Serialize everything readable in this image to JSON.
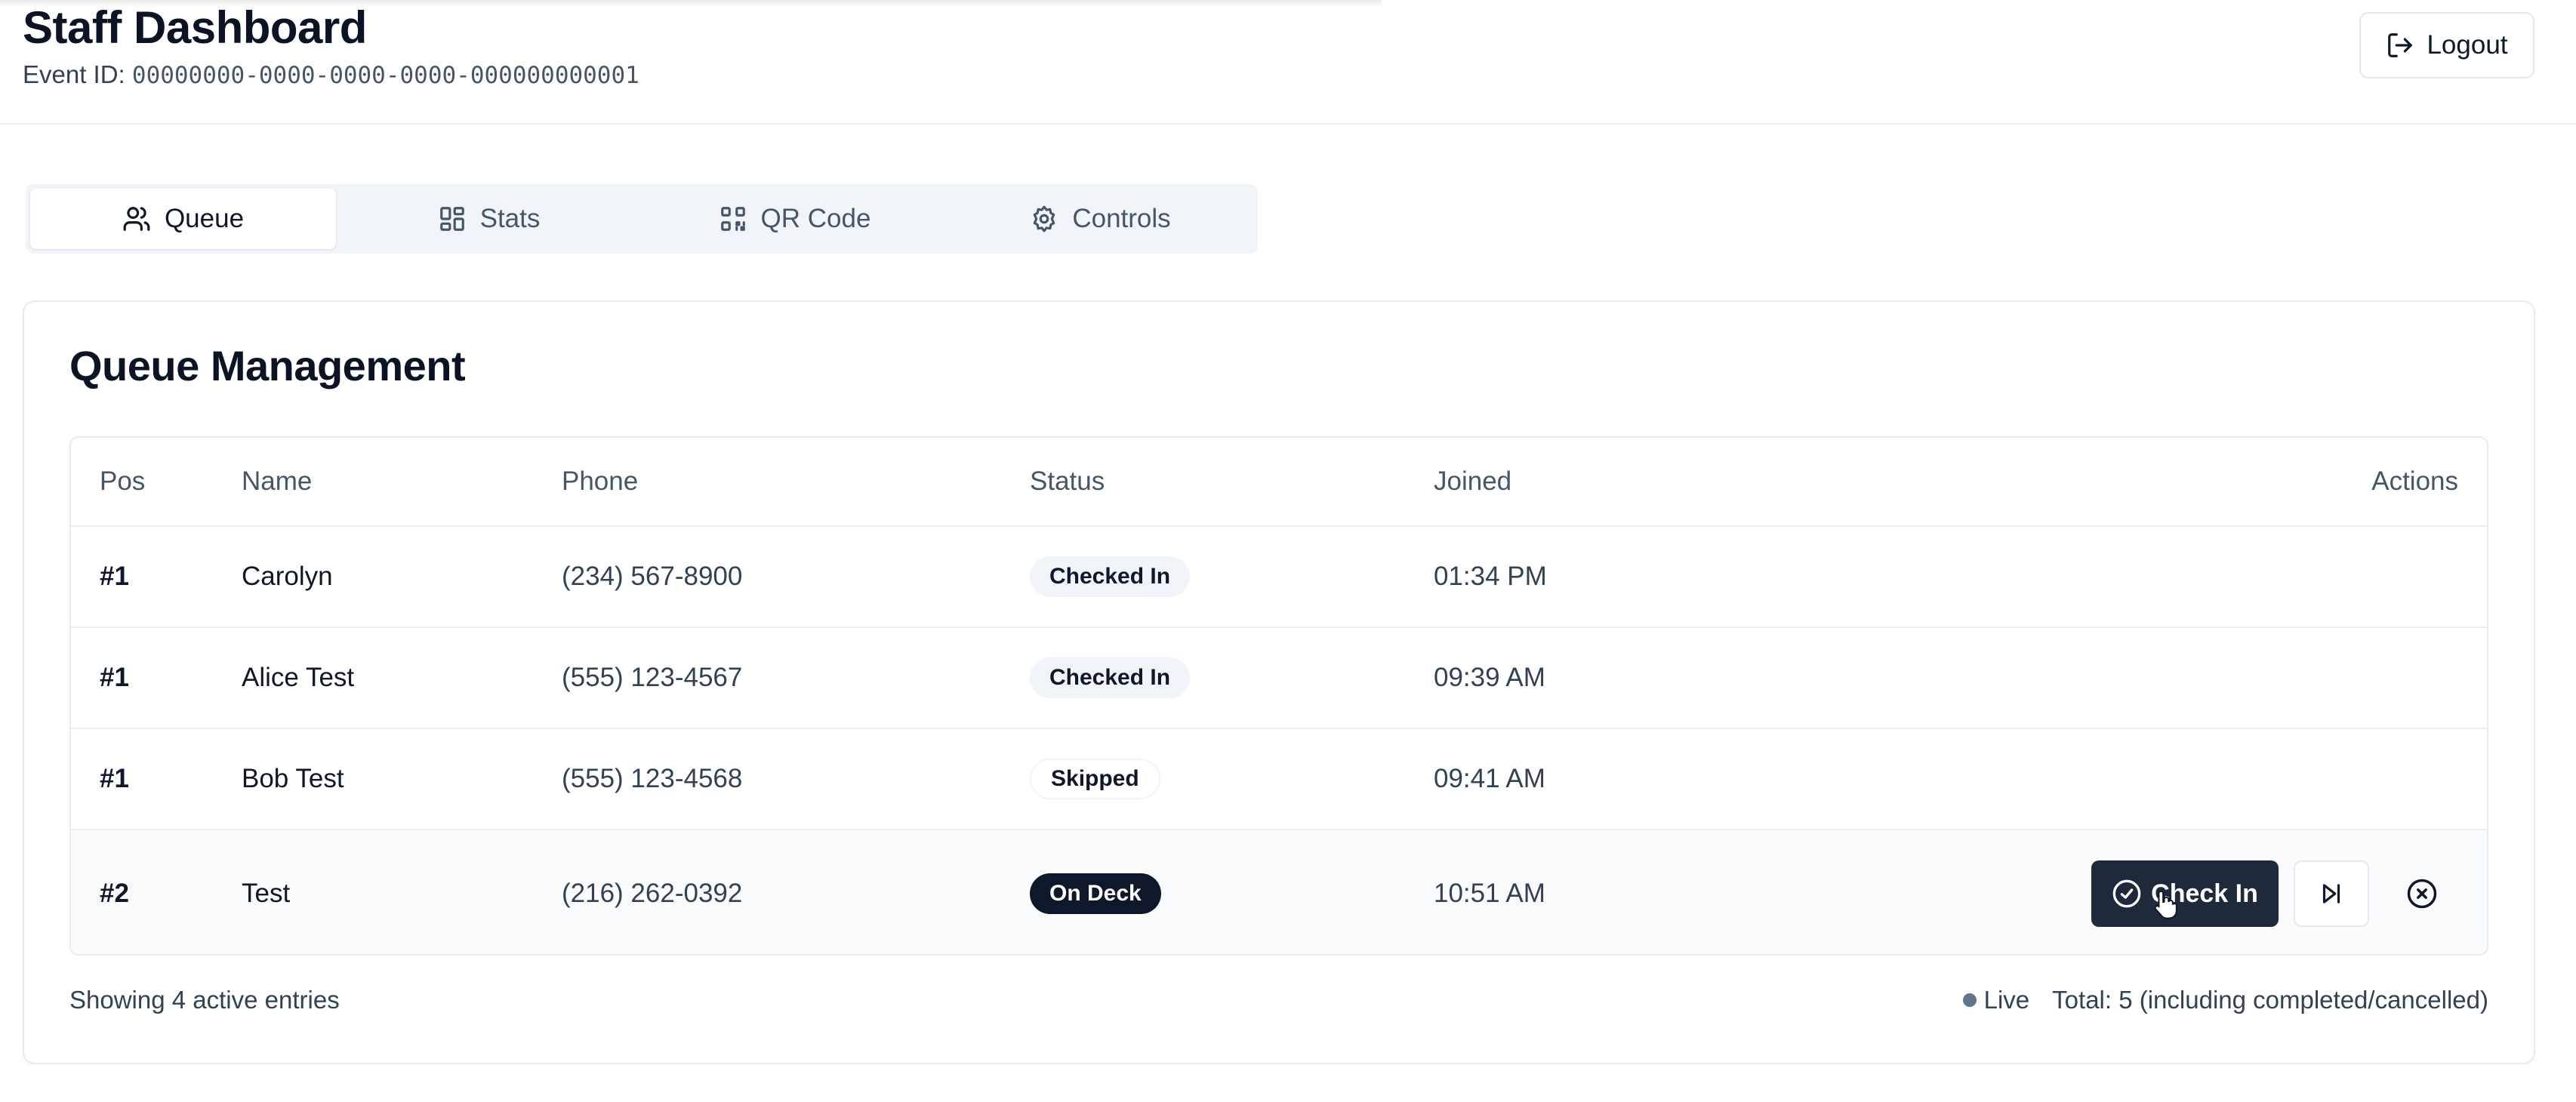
{
  "header": {
    "title": "Staff Dashboard",
    "event_label": "Event ID:",
    "event_id": "00000000-0000-0000-0000-000000000001",
    "logout_label": "Logout"
  },
  "tabs": [
    {
      "label": "Queue",
      "icon": "users-icon",
      "active": true
    },
    {
      "label": "Stats",
      "icon": "dashboard-icon",
      "active": false
    },
    {
      "label": "QR Code",
      "icon": "qr-code-icon",
      "active": false
    },
    {
      "label": "Controls",
      "icon": "settings-icon",
      "active": false
    }
  ],
  "queue": {
    "title": "Queue Management",
    "columns": {
      "pos": "Pos",
      "name": "Name",
      "phone": "Phone",
      "status": "Status",
      "joined": "Joined",
      "actions": "Actions"
    },
    "rows": [
      {
        "pos": "#1",
        "name": "Carolyn",
        "phone": "(234) 567-8900",
        "status": "Checked In",
        "joined": "01:34 PM"
      },
      {
        "pos": "#1",
        "name": "Alice Test",
        "phone": "(555) 123-4567",
        "status": "Checked In",
        "joined": "09:39 AM"
      },
      {
        "pos": "#1",
        "name": "Bob Test",
        "phone": "(555) 123-4568",
        "status": "Skipped",
        "joined": "09:41 AM"
      },
      {
        "pos": "#2",
        "name": "Test",
        "phone": "(216) 262-0392",
        "status": "On Deck",
        "joined": "10:51 AM"
      }
    ],
    "check_in_label": "Check In",
    "footer_left": "Showing 4 active entries",
    "live_label": "Live",
    "total_label": "Total: 5 (including completed/cancelled)"
  },
  "colors": {
    "primary": "#1e293b",
    "badge_dark": "#0f172a",
    "badge_light": "#f1f5f9",
    "border": "#e8ebef"
  }
}
